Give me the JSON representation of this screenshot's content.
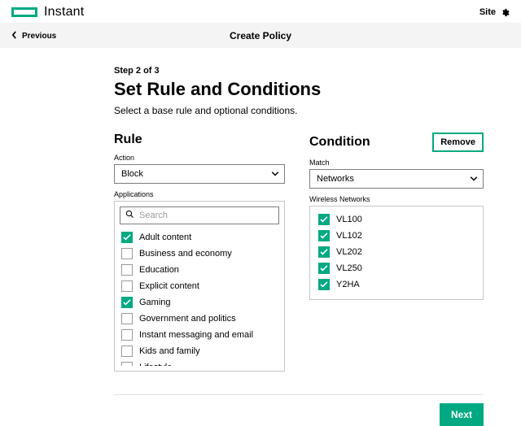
{
  "brand": {
    "product": "Instant",
    "site_label": "Site"
  },
  "header": {
    "back_label": "Previous",
    "title": "Create Policy"
  },
  "step": {
    "indicator": "Step 2 of 3",
    "heading": "Set Rule and Conditions",
    "sub": "Select a base rule and optional conditions."
  },
  "rule": {
    "section_title": "Rule",
    "action_label": "Action",
    "action_value": "Block",
    "apps_label": "Applications",
    "search_placeholder": "Search",
    "apps": [
      {
        "label": "Adult content",
        "checked": true
      },
      {
        "label": "Business and economy",
        "checked": false
      },
      {
        "label": "Education",
        "checked": false
      },
      {
        "label": "Explicit content",
        "checked": false
      },
      {
        "label": "Gaming",
        "checked": true
      },
      {
        "label": "Government and politics",
        "checked": false
      },
      {
        "label": "Instant messaging and email",
        "checked": false
      },
      {
        "label": "Kids and family",
        "checked": false
      },
      {
        "label": "Lifestyle",
        "checked": false
      }
    ]
  },
  "condition": {
    "section_title": "Condition",
    "remove_label": "Remove",
    "match_label": "Match",
    "match_value": "Networks",
    "networks_label": "Wireless Networks",
    "networks": [
      {
        "label": "VL100",
        "checked": true
      },
      {
        "label": "VL102",
        "checked": true
      },
      {
        "label": "VL202",
        "checked": true
      },
      {
        "label": "VL250",
        "checked": true
      },
      {
        "label": "Y2HA",
        "checked": true
      }
    ]
  },
  "footer": {
    "next_label": "Next"
  }
}
